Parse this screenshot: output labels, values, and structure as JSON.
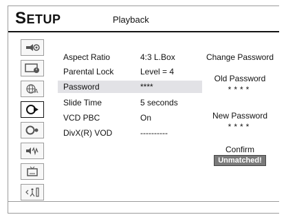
{
  "header": {
    "title_cap": "S",
    "title_rest": "ETUP",
    "section": "Playback"
  },
  "icons": [
    {
      "name": "speaker-settings-icon"
    },
    {
      "name": "clock-screen-icon"
    },
    {
      "name": "language-globe-icon"
    },
    {
      "name": "playback-icon",
      "selected": true
    },
    {
      "name": "record-icon"
    },
    {
      "name": "audio-icon"
    },
    {
      "name": "tv-icon"
    },
    {
      "name": "exit-icon"
    }
  ],
  "settings": [
    {
      "label": "Aspect Ratio",
      "value": "4:3 L.Box"
    },
    {
      "label": "Parental Lock",
      "value": "Level = 4"
    },
    {
      "label": "Password",
      "value": "****",
      "selected": true
    },
    {
      "label": "Slide Time",
      "value": "5 seconds"
    },
    {
      "label": "VCD PBC",
      "value": "On"
    },
    {
      "label": "DivX(R) VOD",
      "value": "----------"
    }
  ],
  "password_panel": {
    "title": "Change Password",
    "old_label": "Old Password",
    "old_value": "****",
    "new_label": "New Password",
    "new_value": "****",
    "confirm_label": "Confirm",
    "confirm_status": "Unmatched!"
  }
}
